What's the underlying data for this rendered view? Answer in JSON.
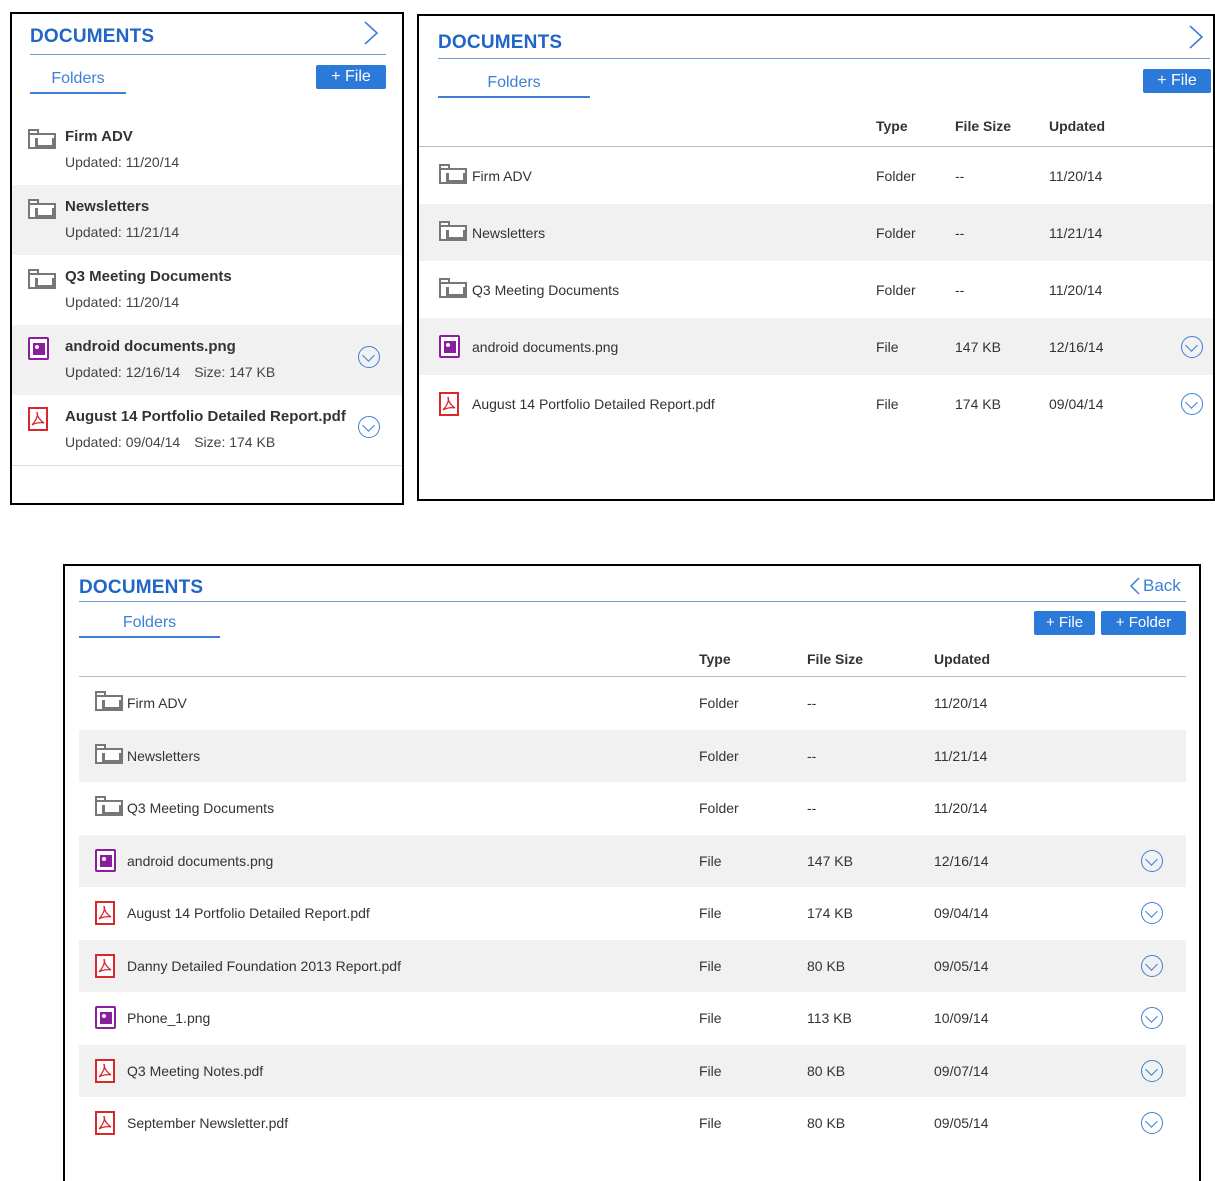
{
  "small": {
    "title": "DOCUMENTS",
    "tab": "Folders",
    "add_file": "+ File",
    "items": [
      {
        "name": "Firm ADV",
        "kind": "folder",
        "updated": "Updated: 11/20/14",
        "size": "",
        "actions": false
      },
      {
        "name": "Newsletters",
        "kind": "folder",
        "updated": "Updated: 11/21/14",
        "size": "",
        "actions": false
      },
      {
        "name": "Q3 Meeting Documents",
        "kind": "folder",
        "updated": "Updated: 11/20/14",
        "size": "",
        "actions": false
      },
      {
        "name": "android documents.png",
        "kind": "image",
        "updated": "Updated: 12/16/14",
        "size": "Size: 147 KB",
        "actions": true
      },
      {
        "name": "August 14 Portfolio Detailed Report.pdf",
        "kind": "pdf",
        "updated": "Updated: 09/04/14",
        "size": "Size: 174 KB",
        "actions": true
      }
    ]
  },
  "medium": {
    "title": "DOCUMENTS",
    "tab": "Folders",
    "add_file": "+ File",
    "columns": {
      "type": "Type",
      "size": "File Size",
      "updated": "Updated"
    },
    "rows": [
      {
        "name": "Firm ADV",
        "kind": "folder",
        "type": "Folder",
        "size": "--",
        "updated": "11/20/14",
        "actions": false
      },
      {
        "name": "Newsletters",
        "kind": "folder",
        "type": "Folder",
        "size": "--",
        "updated": "11/21/14",
        "actions": false
      },
      {
        "name": "Q3 Meeting Documents",
        "kind": "folder",
        "type": "Folder",
        "size": "--",
        "updated": "11/20/14",
        "actions": false
      },
      {
        "name": "android documents.png",
        "kind": "image",
        "type": "File",
        "size": "147 KB",
        "updated": "12/16/14",
        "actions": true
      },
      {
        "name": "August 14 Portfolio Detailed Report.pdf",
        "kind": "pdf",
        "type": "File",
        "size": "174 KB",
        "updated": "09/04/14",
        "actions": true
      }
    ]
  },
  "large": {
    "title": "DOCUMENTS",
    "back": "Back",
    "tab": "Folders",
    "add_file": "+ File",
    "add_folder": "+ Folder",
    "columns": {
      "type": "Type",
      "size": "File Size",
      "updated": "Updated"
    },
    "rows": [
      {
        "name": "Firm ADV",
        "kind": "folder",
        "type": "Folder",
        "size": "--",
        "updated": "11/20/14",
        "actions": false
      },
      {
        "name": "Newsletters",
        "kind": "folder",
        "type": "Folder",
        "size": "--",
        "updated": "11/21/14",
        "actions": false
      },
      {
        "name": "Q3 Meeting Documents",
        "kind": "folder",
        "type": "Folder",
        "size": "--",
        "updated": "11/20/14",
        "actions": false
      },
      {
        "name": "android documents.png",
        "kind": "image",
        "type": "File",
        "size": "147 KB",
        "updated": "12/16/14",
        "actions": true
      },
      {
        "name": "August 14 Portfolio Detailed Report.pdf",
        "kind": "pdf",
        "type": "File",
        "size": "174 KB",
        "updated": "09/04/14",
        "actions": true
      },
      {
        "name": "Danny Detailed Foundation 2013 Report.pdf",
        "kind": "pdf",
        "type": "File",
        "size": "80 KB",
        "updated": "09/05/14",
        "actions": true
      },
      {
        "name": "Phone_1.png",
        "kind": "image",
        "type": "File",
        "size": "113 KB",
        "updated": "10/09/14",
        "actions": true
      },
      {
        "name": "Q3 Meeting Notes.pdf",
        "kind": "pdf",
        "type": "File",
        "size": "80 KB",
        "updated": "09/07/14",
        "actions": true
      },
      {
        "name": "September Newsletter.pdf",
        "kind": "pdf",
        "type": "File",
        "size": "80 KB",
        "updated": "09/05/14",
        "actions": true
      }
    ]
  }
}
